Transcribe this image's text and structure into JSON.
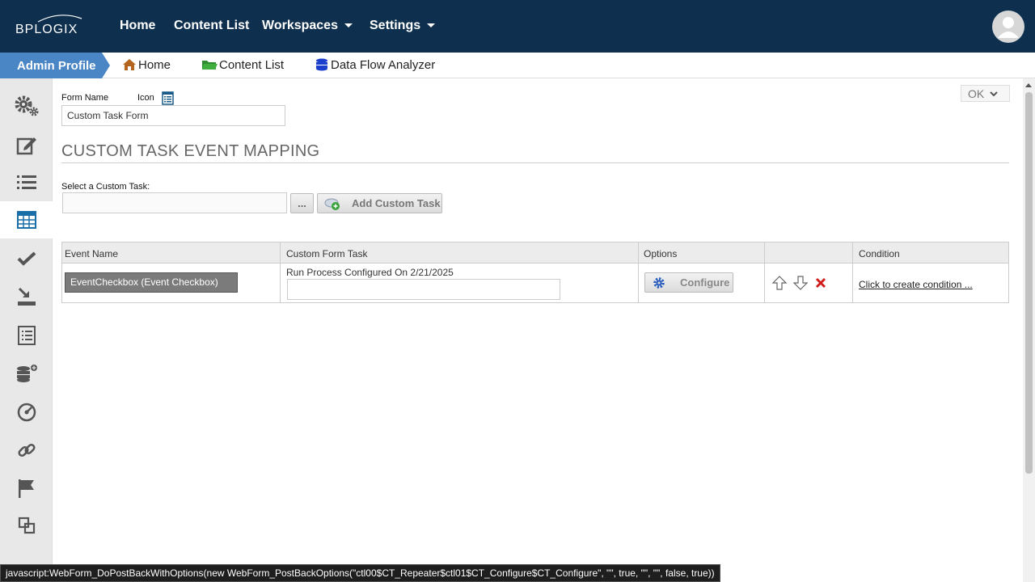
{
  "topnav": {
    "logo_text": "BPLOGIX",
    "items": [
      {
        "label": "Home"
      },
      {
        "label": "Content List"
      },
      {
        "label": "Workspaces"
      },
      {
        "label": "Settings"
      }
    ]
  },
  "breadcrumb": {
    "active": "Admin Profile",
    "items": [
      {
        "label": "Home",
        "icon": "house-icon"
      },
      {
        "label": "Content List",
        "icon": "folder-icon"
      },
      {
        "label": "Data Flow Analyzer",
        "icon": "database-icon"
      }
    ]
  },
  "sidebar": {
    "items": [
      {
        "icon": "gears-icon"
      },
      {
        "icon": "edit-icon"
      },
      {
        "icon": "list-icon"
      },
      {
        "icon": "table-icon",
        "active": true
      },
      {
        "icon": "checkmark-icon"
      },
      {
        "icon": "download-tray-icon"
      },
      {
        "icon": "document-list-icon"
      },
      {
        "icon": "database-add-icon"
      },
      {
        "icon": "dashboard-icon"
      },
      {
        "icon": "link-icon"
      },
      {
        "icon": "flag-icon"
      },
      {
        "icon": "copy-icon"
      }
    ]
  },
  "form": {
    "form_name_label": "Form Name",
    "icon_label": "Icon",
    "form_name_value": "Custom Task Form",
    "ok_label": "OK"
  },
  "section": {
    "title": "CUSTOM TASK EVENT MAPPING",
    "select_label": "Select a Custom Task:",
    "select_value": "",
    "browse_label": "...",
    "add_button_label": "Add Custom Task"
  },
  "table": {
    "headers": [
      "Event Name",
      "Custom Form Task",
      "Options",
      "",
      "Condition"
    ],
    "rows": [
      {
        "event": "EventCheckbox (Event Checkbox)",
        "task_text": "Run Process Configured On 2/21/2025",
        "task_input": "",
        "configure_label": "Configure",
        "condition_link": "Click to create condition ..."
      }
    ]
  },
  "statusbar": {
    "text": "javascript:WebForm_DoPostBackWithOptions(new WebForm_PostBackOptions(\"ctl00$CT_Repeater$ctl01$CT_Configure$CT_Configure\", \"\", true, \"\", \"\", false, true))"
  },
  "colors": {
    "topbar": "#0e2f4d",
    "admin_tab": "#4a86c5",
    "delete_red": "#d11a1a"
  }
}
